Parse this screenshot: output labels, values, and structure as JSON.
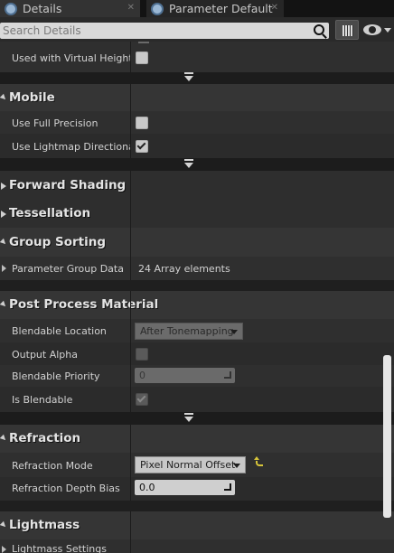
{
  "tabs": [
    {
      "label": "Details",
      "icon": "details-search-icon"
    },
    {
      "label": "Parameter Default",
      "icon": "parameter-search-icon"
    }
  ],
  "search": {
    "placeholder": "Search Details"
  },
  "toolbar": {
    "grid_icon": "property-matrix-icon",
    "eye_icon": "visibility-eye-icon"
  },
  "rows": {
    "virtual_heightfield": {
      "label": "Used with Virtual Heightfie",
      "checked": false
    },
    "mobile": {
      "title": "Mobile"
    },
    "use_full_precision": {
      "label": "Use Full Precision",
      "checked": false
    },
    "use_lightmap_directionality": {
      "label": "Use Lightmap Directionalit",
      "checked": true
    },
    "forward_shading": {
      "title": "Forward Shading"
    },
    "tessellation": {
      "title": "Tessellation"
    },
    "group_sorting": {
      "title": "Group Sorting"
    },
    "parameter_group_data": {
      "label": "Parameter Group Data",
      "value": "24 Array elements"
    },
    "post_process_material": {
      "title": "Post Process Material"
    },
    "blendable_location": {
      "label": "Blendable Location",
      "value": "After Tonemapping"
    },
    "output_alpha": {
      "label": "Output Alpha",
      "checked": false
    },
    "blendable_priority": {
      "label": "Blendable Priority",
      "value": "0"
    },
    "is_blendable": {
      "label": "Is Blendable",
      "checked": true
    },
    "refraction": {
      "title": "Refraction"
    },
    "refraction_mode": {
      "label": "Refraction Mode",
      "value": "Pixel Normal Offset"
    },
    "refraction_depth_bias": {
      "label": "Refraction Depth Bias",
      "value": "0.0"
    },
    "lightmass": {
      "title": "Lightmass"
    },
    "lightmass_settings": {
      "label": "Lightmass Settings"
    }
  },
  "colors": {
    "background": "#242424",
    "category": "#353535",
    "accent_reset": "#d7c53a"
  }
}
